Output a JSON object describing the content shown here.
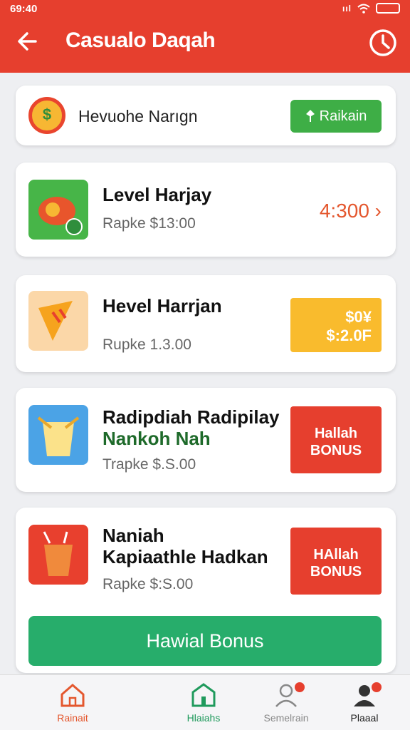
{
  "status_bar": {
    "time": "69:40",
    "signal": "ııl"
  },
  "header": {
    "title": "Casualo Daqah"
  },
  "top_card": {
    "label": "Hevuohe Narıgn",
    "button_label": "Raikain"
  },
  "items": [
    {
      "name": "Level Harjay",
      "price": "Rapke $13:00",
      "side_value": "4:300 ›"
    },
    {
      "name": "Hevel Harrjan",
      "price": "Rupke 1.3.00",
      "promo_line1": "$0¥",
      "promo_line2": "$:2.0F"
    },
    {
      "name_line1": "Radipdiah Radipilay",
      "name_line2": "Nankoh Nah",
      "price": "Trapke $.S.00",
      "bonus_line1": "Hallah",
      "bonus_line2": "BONUS"
    },
    {
      "name_line1": "Naniah",
      "name_line2": "Kapiaathle Hadkan",
      "price": "Rapke $:S.00",
      "bonus_line1": "HAllah",
      "bonus_line2": "BONUS"
    }
  ],
  "cta_button": {
    "label": "Hawial Bonus"
  },
  "bottom_nav": [
    {
      "label": "Rainait",
      "icon": "home-icon"
    },
    {
      "label": "Hlaiahs",
      "icon": "home-icon"
    },
    {
      "label": "Semelrain",
      "icon": "person-icon"
    },
    {
      "label": "Plaaal",
      "icon": "person-filled-icon"
    }
  ],
  "colors": {
    "brand_red": "#e63f2e",
    "green": "#3eae46",
    "cta_green": "#27ad6b",
    "promo_yellow": "#f9bb2d"
  }
}
